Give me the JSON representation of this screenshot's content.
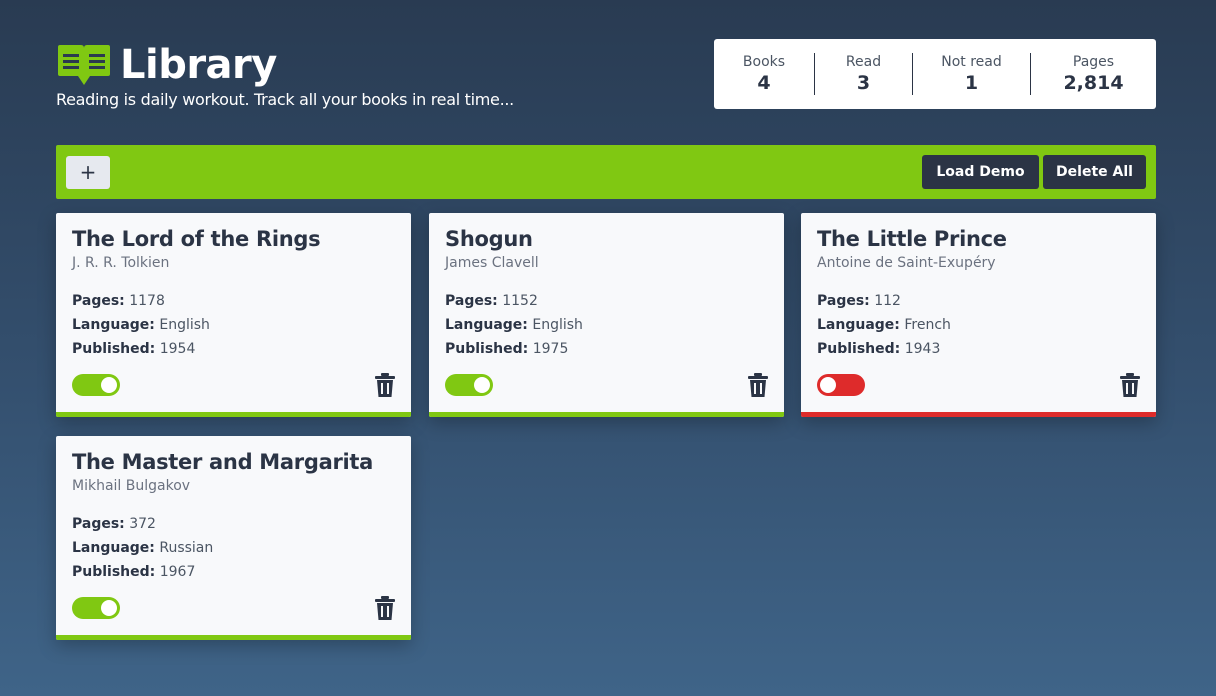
{
  "app": {
    "title": "Library",
    "tagline": "Reading is daily workout. Track all your books in real time..."
  },
  "stats": [
    {
      "label": "Books",
      "value": "4"
    },
    {
      "label": "Read",
      "value": "3"
    },
    {
      "label": "Not read",
      "value": "1"
    },
    {
      "label": "Pages",
      "value": "2,814"
    }
  ],
  "toolbar": {
    "add_label": "+",
    "load_demo_label": "Load Demo",
    "delete_all_label": "Delete All"
  },
  "labels": {
    "pages": "Pages:",
    "language": "Language:",
    "published": "Published:"
  },
  "books": [
    {
      "title": "The Lord of the Rings",
      "author": "J. R. R. Tolkien",
      "pages": "1178",
      "language": "English",
      "published": "1954",
      "read": true
    },
    {
      "title": "Shogun",
      "author": "James Clavell",
      "pages": "1152",
      "language": "English",
      "published": "1975",
      "read": true
    },
    {
      "title": "The Little Prince",
      "author": "Antoine de Saint-Exupéry",
      "pages": "112",
      "language": "French",
      "published": "1943",
      "read": false
    },
    {
      "title": "The Master and Margarita",
      "author": "Mikhail Bulgakov",
      "pages": "372",
      "language": "Russian",
      "published": "1967",
      "read": true
    }
  ],
  "colors": {
    "accent": "#80c812",
    "unread": "#de2b2b",
    "dark": "#2b3445"
  },
  "icons": {
    "logo": "open-book-icon",
    "delete": "trash-icon"
  }
}
